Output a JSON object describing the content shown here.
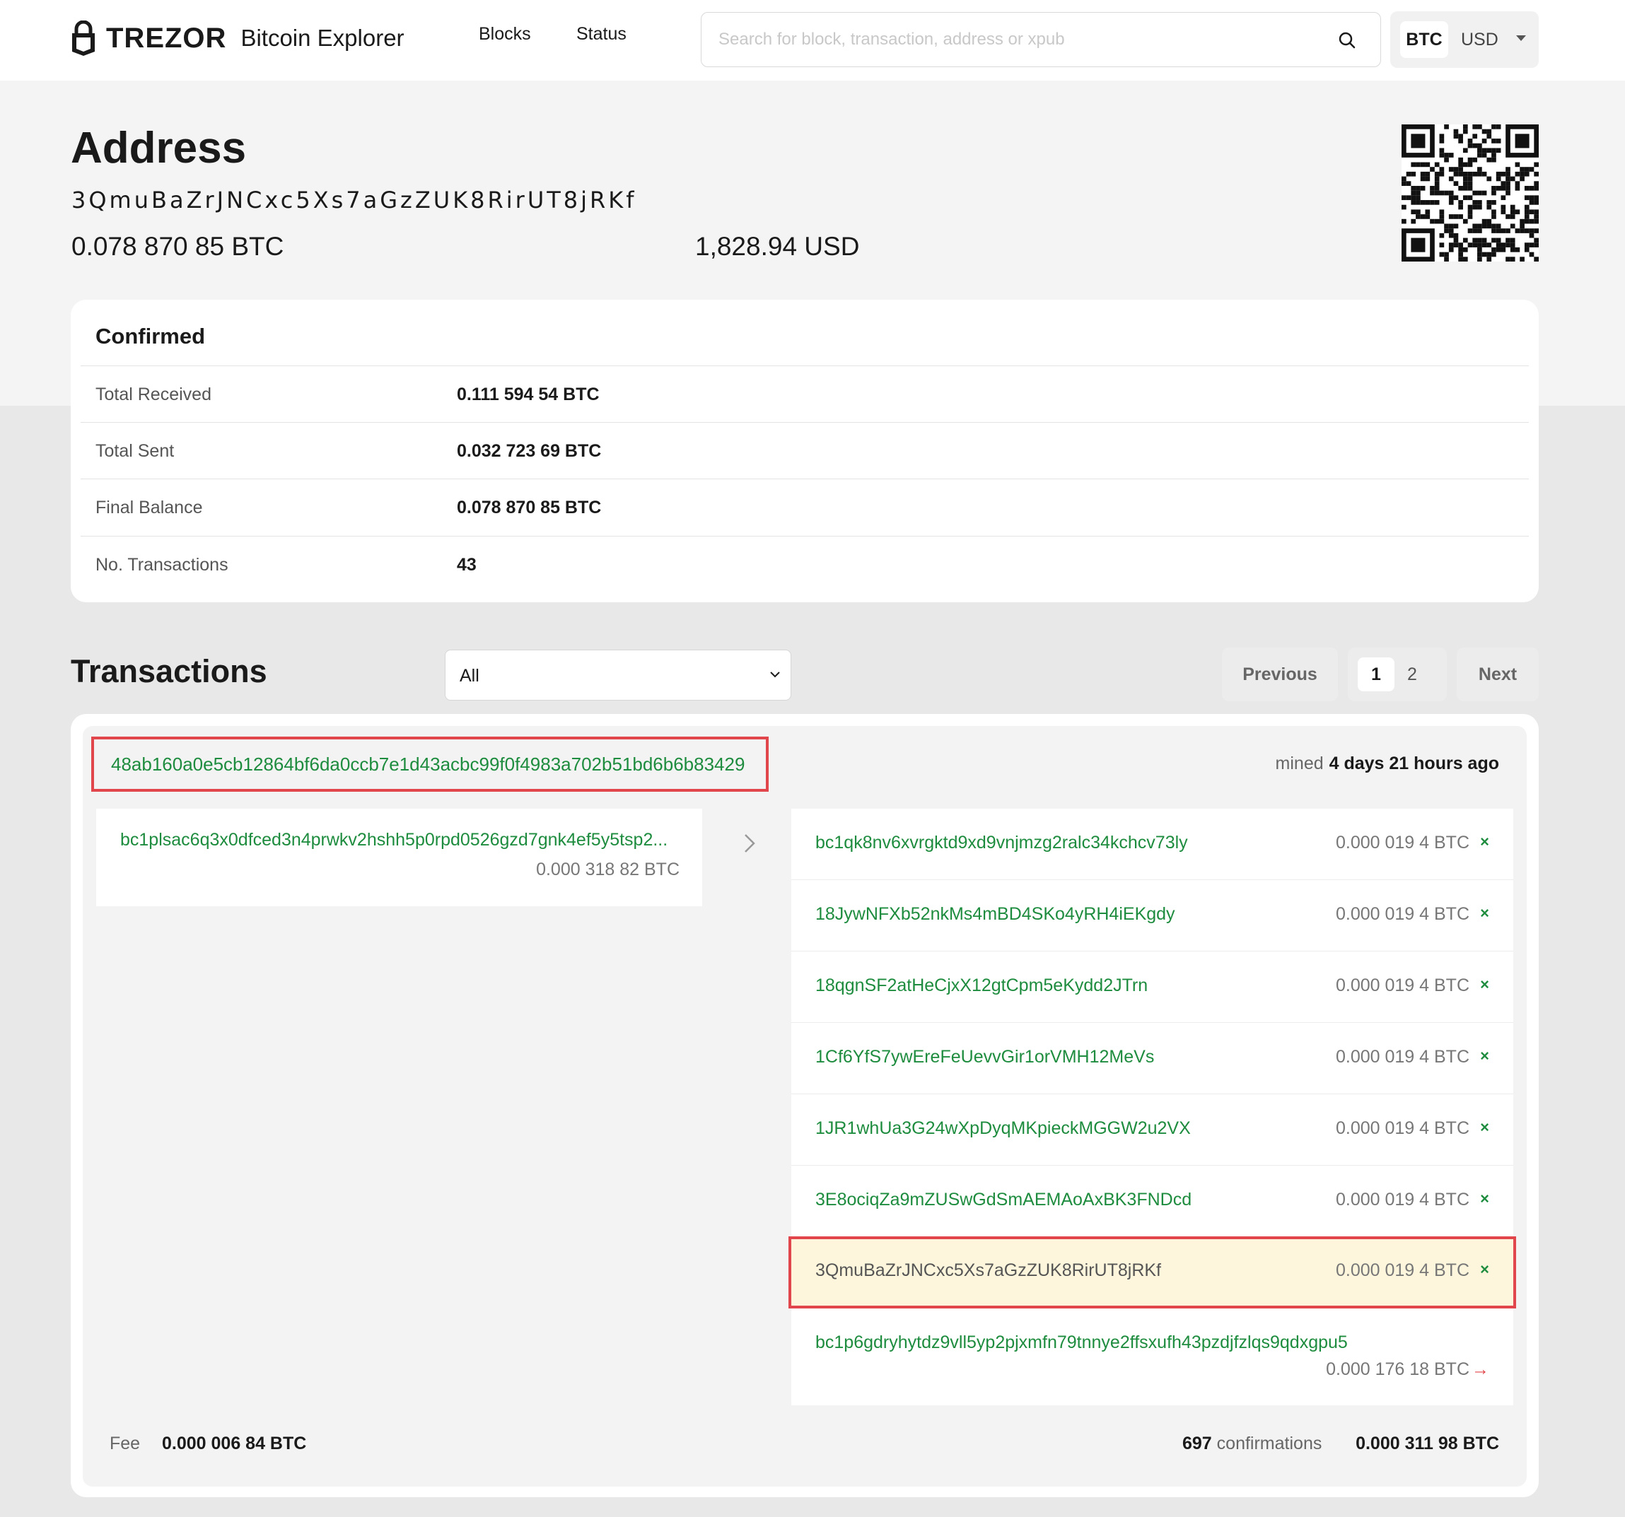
{
  "header": {
    "brand_name": "TREZOR",
    "brand_sub": "Bitcoin Explorer",
    "nav": {
      "blocks": "Blocks",
      "status": "Status"
    },
    "search_placeholder": "Search for block, transaction, address or xpub",
    "currency": {
      "selected": "BTC",
      "fiat": "USD"
    }
  },
  "address": {
    "title": "Address",
    "value": "3QmuBaZrJNCxc5Xs7aGzZUK8RirUT8jRKf",
    "balance_btc": "0.078 870 85 BTC",
    "balance_usd": "1,828.94 USD"
  },
  "confirmed": {
    "title": "Confirmed",
    "rows": [
      {
        "label": "Total Received",
        "value": "0.111 594 54 BTC"
      },
      {
        "label": "Total Sent",
        "value": "0.032 723 69 BTC"
      },
      {
        "label": "Final Balance",
        "value": "0.078 870 85 BTC"
      },
      {
        "label": "No. Transactions",
        "value": "43"
      }
    ]
  },
  "transactions": {
    "title": "Transactions",
    "filter": "All",
    "pagination": {
      "previous": "Previous",
      "pages": [
        "1",
        "2"
      ],
      "current": "1",
      "next": "Next"
    },
    "tx": {
      "hash": "48ab160a0e5cb12864bf6da0ccb7e1d43acbc99f0f4983a702b51bd6b6b83429",
      "mined_label": "mined",
      "mined_time": "4 days 21 hours ago",
      "inputs": [
        {
          "address": "bc1plsac6q3x0dfced3n4prwkv2hshh5p0rpd0526gzd7gnk4ef5y5tsp2...",
          "amount": "0.000 318 82 BTC"
        }
      ],
      "outputs": [
        {
          "address": "bc1qk8nv6xvrgktd9xd9vnjmzg2ralc34kchcv73ly",
          "amount": "0.000 019 4 BTC",
          "mark": "×"
        },
        {
          "address": "18JywNFXb52nkMs4mBD4SKo4yRH4iEKgdy",
          "amount": "0.000 019 4 BTC",
          "mark": "×"
        },
        {
          "address": "18qgnSF2atHeCjxX12gtCpm5eKydd2JTrn",
          "amount": "0.000 019 4 BTC",
          "mark": "×"
        },
        {
          "address": "1Cf6YfS7ywEreFeUevvGir1orVMH12MeVs",
          "amount": "0.000 019 4 BTC",
          "mark": "×"
        },
        {
          "address": "1JR1whUa3G24wXpDyqMKpieckMGGW2u2VX",
          "amount": "0.000 019 4 BTC",
          "mark": "×"
        },
        {
          "address": "3E8ociqZa9mZUSwGdSmAEMAoAxBK3FNDcd",
          "amount": "0.000 019 4 BTC",
          "mark": "×"
        },
        {
          "address": "3QmuBaZrJNCxc5Xs7aGzZUK8RirUT8jRKf",
          "amount": "0.000 019 4 BTC",
          "mark": "×"
        },
        {
          "address": "bc1p6gdryhytdz9vll5yp2pjxmfn79tnnye2ffsxufh43pzdjfzlqs9qdxgpu5",
          "amount": "0.000 176 18 BTC",
          "mark": "→"
        }
      ],
      "fee_label": "Fee",
      "fee": "0.000 006 84 BTC",
      "confirmations_count": "697",
      "confirmations_label": "confirmations",
      "total": "0.000 311 98 BTC"
    }
  },
  "colors": {
    "link_green": "#1e8c3e",
    "highlight_border": "#e0464b",
    "highlight_bg": "#fdf6dc"
  }
}
